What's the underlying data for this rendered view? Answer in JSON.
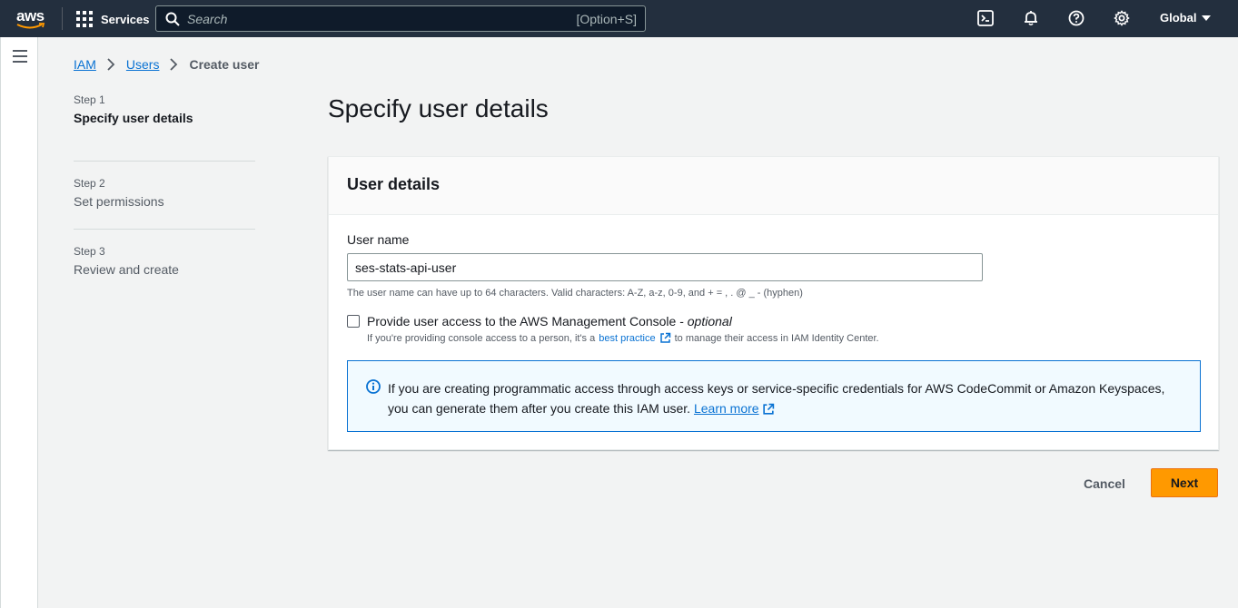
{
  "topnav": {
    "logo_text": "aws",
    "services_label": "Services",
    "search_placeholder": "Search",
    "search_shortcut": "[Option+S]",
    "region_label": "Global",
    "icons": [
      "cloudshell-icon",
      "bell-icon",
      "help-icon",
      "gear-icon"
    ]
  },
  "breadcrumb": {
    "items": [
      {
        "label": "IAM",
        "link": true
      },
      {
        "label": "Users",
        "link": true
      },
      {
        "label": "Create user",
        "link": false
      }
    ]
  },
  "steps": [
    {
      "num": "Step 1",
      "title": "Specify user details",
      "active": true
    },
    {
      "num": "Step 2",
      "title": "Set permissions",
      "active": false
    },
    {
      "num": "Step 3",
      "title": "Review and create",
      "active": false
    }
  ],
  "page": {
    "title": "Specify user details"
  },
  "panel": {
    "header": "User details",
    "username_label": "User name",
    "username_value": "ses-stats-api-user",
    "username_hint": "The user name can have up to 64 characters. Valid characters: A-Z, a-z, 0-9, and + = , . @ _ - (hyphen)",
    "console_access_label": "Provide user access to the AWS Management Console - ",
    "console_access_optional": "optional",
    "console_access_checked": false,
    "console_desc_before": "If you're providing console access to a person, it's a",
    "console_desc_link": "best practice",
    "console_desc_after": "to manage their access in IAM Identity Center."
  },
  "info": {
    "message": "If you are creating programmatic access through access keys or service-specific credentials for AWS CodeCommit or Amazon Keyspaces, you can generate them after you create this IAM user.",
    "link": "Learn more"
  },
  "actions": {
    "cancel_label": "Cancel",
    "next_label": "Next"
  },
  "colors": {
    "nav_bg": "#232f3e",
    "link": "#0972d3",
    "primary_button": "#ff9900",
    "info_bg": "#f1faff"
  }
}
